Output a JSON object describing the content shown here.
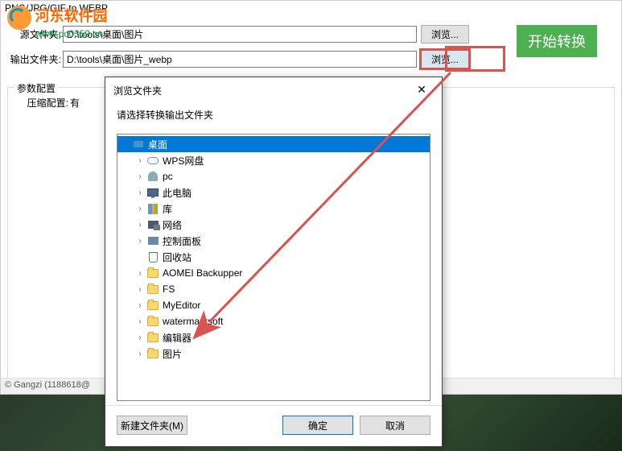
{
  "window": {
    "title": "PNG/JPG/GIF to WEBP"
  },
  "watermark": {
    "name": "河东软件园",
    "url": "www.pc0359.cn"
  },
  "form": {
    "source_label": "源文件夹:",
    "source_value": "D:\\tools\\桌面\\图片",
    "output_label": "输出文件夹:",
    "output_value": "D:\\tools\\桌面\\图片_webp",
    "browse_label": "浏览...",
    "start_label": "开始转换"
  },
  "params": {
    "group_title": "参数配置",
    "compress_label": "压缩配置:",
    "compress_value": "有"
  },
  "status": "© Gangzi (1188618@",
  "dialog": {
    "title": "浏览文件夹",
    "instruction": "请选择转换输出文件夹",
    "new_folder": "新建文件夹(M)",
    "ok": "确定",
    "cancel": "取消",
    "tree": [
      {
        "label": "桌面",
        "icon": "desktop",
        "depth": 0,
        "expander": "",
        "selected": true
      },
      {
        "label": "WPS网盘",
        "icon": "cloud",
        "depth": 1,
        "expander": "›"
      },
      {
        "label": "pc",
        "icon": "user",
        "depth": 1,
        "expander": "›"
      },
      {
        "label": "此电脑",
        "icon": "monitor",
        "depth": 1,
        "expander": "›"
      },
      {
        "label": "库",
        "icon": "lib",
        "depth": 1,
        "expander": "›"
      },
      {
        "label": "网络",
        "icon": "net",
        "depth": 1,
        "expander": "›"
      },
      {
        "label": "控制面板",
        "icon": "panel",
        "depth": 1,
        "expander": "›"
      },
      {
        "label": "回收站",
        "icon": "recycle",
        "depth": 1,
        "expander": ""
      },
      {
        "label": "AOMEI Backupper",
        "icon": "folder",
        "depth": 1,
        "expander": "›"
      },
      {
        "label": "FS",
        "icon": "folder",
        "depth": 1,
        "expander": "›"
      },
      {
        "label": "MyEditor",
        "icon": "folder",
        "depth": 1,
        "expander": "›"
      },
      {
        "label": "watermarksoft",
        "icon": "folder",
        "depth": 1,
        "expander": "›"
      },
      {
        "label": "编辑器",
        "icon": "folder",
        "depth": 1,
        "expander": "›"
      },
      {
        "label": "图片",
        "icon": "folder",
        "depth": 1,
        "expander": "›"
      }
    ]
  }
}
